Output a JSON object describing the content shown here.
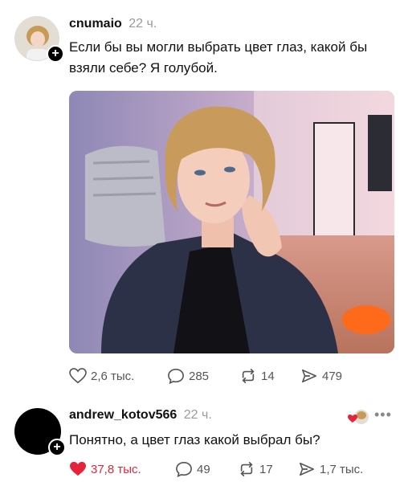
{
  "post": {
    "author": "cnumaio",
    "time": "22 ч.",
    "text": "Если бы вы могли выбрать цвет глаз, какой бы взяли себе? Я голубой.",
    "stats": {
      "likes": "2,6 тыс.",
      "comments": "285",
      "reposts": "14",
      "shares": "479"
    }
  },
  "comment": {
    "author": "andrew_kotov566",
    "time": "22 ч.",
    "text": "Понятно, а цвет глаз какой выбрал бы?",
    "stats": {
      "likes": "37,8 тыс.",
      "comments": "49",
      "reposts": "17",
      "shares": "1,7 тыс."
    }
  },
  "colors": {
    "like_red": "#e5243b",
    "muted": "#9a9a9a"
  },
  "icons": [
    "plus-icon",
    "heart-icon",
    "comment-icon",
    "repost-icon",
    "share-icon",
    "more-icon"
  ]
}
